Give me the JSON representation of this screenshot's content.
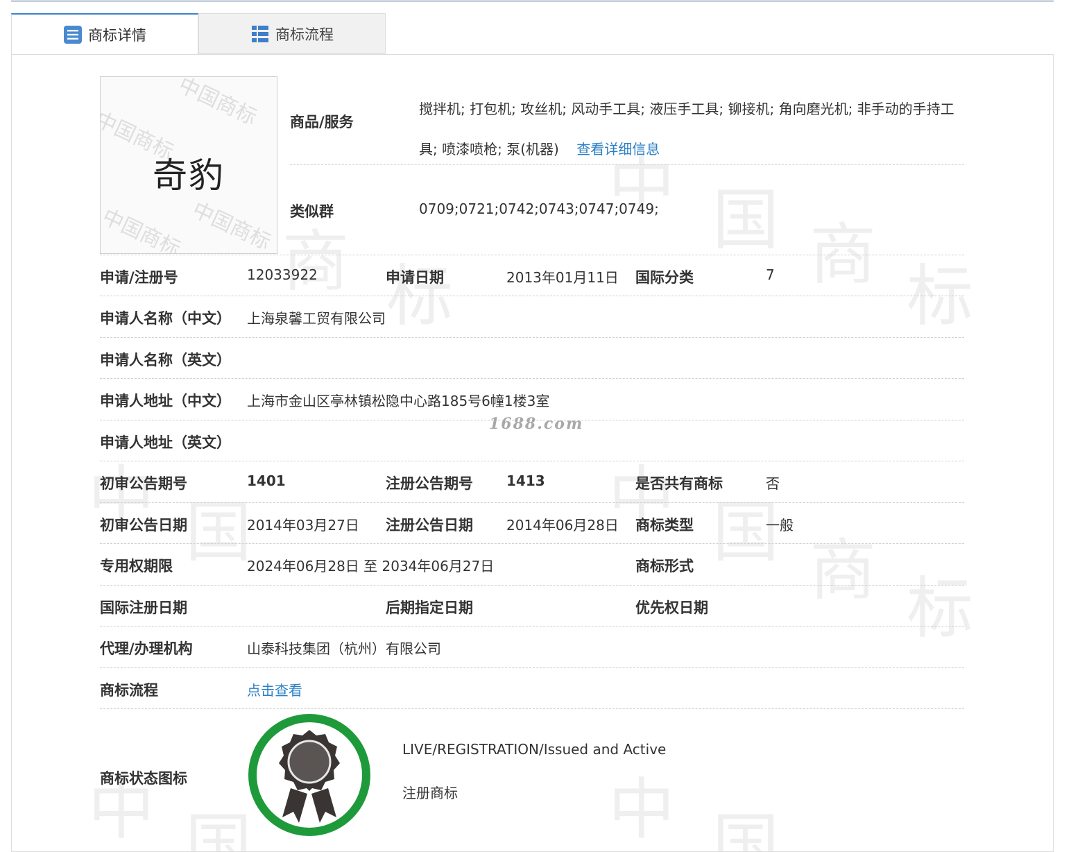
{
  "tabs": {
    "detail_label": "商标详情",
    "flow_label": "商标流程"
  },
  "logo": {
    "text": "奇豹",
    "watermark": "中国商标"
  },
  "goods": {
    "label": "商品/服务",
    "value": "搅拌机; 打包机; 攻丝机; 风动手工具; 液压手工具; 铆接机; 角向磨光机; 非手动的手持工具; 喷漆喷枪; 泵(机器)",
    "detail_link": "查看详细信息"
  },
  "similar_group": {
    "label": "类似群",
    "value": "0709;0721;0742;0743;0747;0749;"
  },
  "row_reg": {
    "reg_no_label": "申请/注册号",
    "reg_no": "12033922",
    "app_date_label": "申请日期",
    "app_date": "2013年01月11日",
    "intl_class_label": "国际分类",
    "intl_class": "7"
  },
  "applicant_cn": {
    "label": "申请人名称（中文）",
    "value": "上海泉馨工贸有限公司"
  },
  "applicant_en": {
    "label": "申请人名称（英文）",
    "value": ""
  },
  "address_cn": {
    "label": "申请人地址（中文）",
    "value": "上海市金山区亭林镇松隐中心路185号6幢1楼3室"
  },
  "address_en": {
    "label": "申请人地址（英文）",
    "value": ""
  },
  "row_announce": {
    "prelim_no_label": "初审公告期号",
    "prelim_no": "1401",
    "reg_no_label": "注册公告期号",
    "reg_no": "1413",
    "shared_label": "是否共有商标",
    "shared": "否"
  },
  "row_dates": {
    "prelim_date_label": "初审公告日期",
    "prelim_date": "2014年03月27日",
    "reg_date_label": "注册公告日期",
    "reg_date": "2014年06月28日",
    "type_label": "商标类型",
    "type": "一般"
  },
  "row_term": {
    "term_label": "专用权期限",
    "term": "2024年06月28日 至 2034年06月27日",
    "form_label": "商标形式",
    "form": ""
  },
  "row_intl": {
    "intl_reg_label": "国际注册日期",
    "later_label": "后期指定日期",
    "priority_label": "优先权日期"
  },
  "agent": {
    "label": "代理/办理机构",
    "value": "山泰科技集团（杭州）有限公司"
  },
  "flow": {
    "label": "商标流程",
    "link": "点击查看"
  },
  "status": {
    "label": "商标状态图标",
    "en": "LIVE/REGISTRATION/Issued and Active",
    "cn": "注册商标",
    "ring_color": "#1f9a3a"
  },
  "site_watermark": "1688.com",
  "background_watermark": [
    "中",
    "国",
    "商",
    "标"
  ],
  "colors": {
    "link": "#2b7fc4",
    "tab_accent": "#3a83c9"
  }
}
